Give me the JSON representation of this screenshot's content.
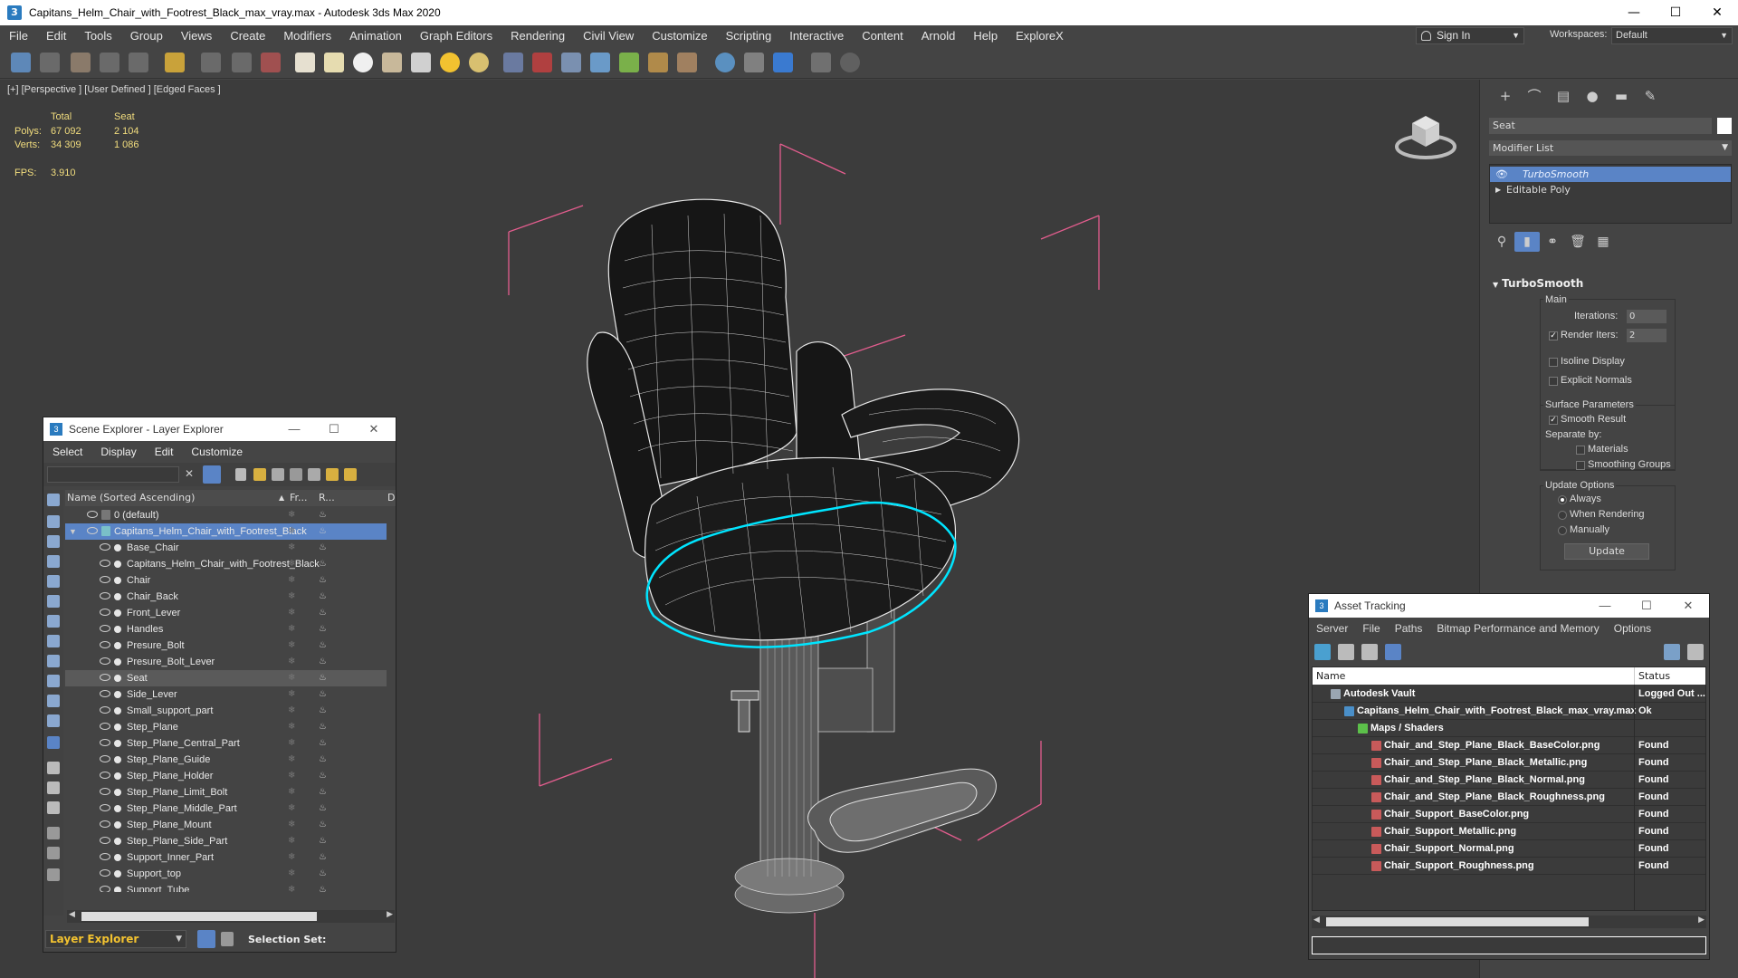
{
  "window": {
    "title": "Capitans_Helm_Chair_with_Footrest_Black_max_vray.max - Autodesk 3ds Max 2020",
    "app_icon": "3",
    "minimize": "—",
    "maximize": "☐",
    "close": "✕"
  },
  "menubar": {
    "items": [
      "File",
      "Edit",
      "Tools",
      "Group",
      "Views",
      "Create",
      "Modifiers",
      "Animation",
      "Graph Editors",
      "Rendering",
      "Civil View",
      "Customize",
      "Scripting",
      "Interactive",
      "Content",
      "Arnold",
      "Help",
      "ExploreX"
    ],
    "sign_in": "Sign In",
    "workspaces_label": "Workspaces:",
    "workspace_value": "Default"
  },
  "viewport": {
    "label": "[+] [Perspective ] [User Defined ] [Edged Faces ]",
    "stats": {
      "header_total": "Total",
      "header_seat": "Seat",
      "polys_label": "Polys:",
      "polys_total": "67 092",
      "polys_seat": "2 104",
      "verts_label": "Verts:",
      "verts_total": "34 309",
      "verts_seat": "1 086",
      "fps_label": "FPS:",
      "fps_value": "3.910"
    }
  },
  "command_panel": {
    "tabs": [
      "+",
      "⌒",
      "▤",
      "●",
      "▬",
      "✎"
    ],
    "object_name": "Seat",
    "modifier_list": "Modifier List",
    "stack": [
      "TurboSmooth",
      "Editable Poly"
    ],
    "stack_tools": [
      "⚲",
      "▮",
      "⚭",
      "🗑",
      "▦"
    ],
    "rollout": {
      "title": "TurboSmooth",
      "main": "Main",
      "iterations_label": "Iterations:",
      "iterations_value": "0",
      "render_iters_label": "Render Iters:",
      "render_iters_value": "2",
      "isoline": "Isoline Display",
      "explicit_normals": "Explicit Normals",
      "surface_params": "Surface Parameters",
      "smooth_result": "Smooth Result",
      "separate_by": "Separate by:",
      "materials": "Materials",
      "smoothing_groups": "Smoothing Groups",
      "update_options": "Update Options",
      "always": "Always",
      "when_rendering": "When Rendering",
      "manually": "Manually",
      "update_button": "Update"
    }
  },
  "scene_explorer": {
    "title": "Scene Explorer - Layer Explorer",
    "menu": [
      "Select",
      "Display",
      "Edit",
      "Customize"
    ],
    "col_name": "Name (Sorted Ascending)",
    "col_frozen": "Fr...",
    "col_render": "R...",
    "col_d": "D",
    "rows": [
      {
        "name": "0 (default)",
        "level": 0,
        "selected": false,
        "highlight": false
      },
      {
        "name": "Capitans_Helm_Chair_with_Footrest_Black",
        "level": 0,
        "selected": true,
        "highlight": false
      },
      {
        "name": "Base_Chair",
        "level": 1,
        "selected": false,
        "highlight": false
      },
      {
        "name": "Capitans_Helm_Chair_with_Footrest_Black",
        "level": 1,
        "selected": false,
        "highlight": false
      },
      {
        "name": "Chair",
        "level": 1,
        "selected": false,
        "highlight": false
      },
      {
        "name": "Chair_Back",
        "level": 1,
        "selected": false,
        "highlight": false
      },
      {
        "name": "Front_Lever",
        "level": 1,
        "selected": false,
        "highlight": false
      },
      {
        "name": "Handles",
        "level": 1,
        "selected": false,
        "highlight": false
      },
      {
        "name": "Presure_Bolt",
        "level": 1,
        "selected": false,
        "highlight": false
      },
      {
        "name": "Presure_Bolt_Lever",
        "level": 1,
        "selected": false,
        "highlight": false
      },
      {
        "name": "Seat",
        "level": 1,
        "selected": false,
        "highlight": true
      },
      {
        "name": "Side_Lever",
        "level": 1,
        "selected": false,
        "highlight": false
      },
      {
        "name": "Small_support_part",
        "level": 1,
        "selected": false,
        "highlight": false
      },
      {
        "name": "Step_Plane",
        "level": 1,
        "selected": false,
        "highlight": false
      },
      {
        "name": "Step_Plane_Central_Part",
        "level": 1,
        "selected": false,
        "highlight": false
      },
      {
        "name": "Step_Plane_Guide",
        "level": 1,
        "selected": false,
        "highlight": false
      },
      {
        "name": "Step_Plane_Holder",
        "level": 1,
        "selected": false,
        "highlight": false
      },
      {
        "name": "Step_Plane_Limit_Bolt",
        "level": 1,
        "selected": false,
        "highlight": false
      },
      {
        "name": "Step_Plane_Middle_Part",
        "level": 1,
        "selected": false,
        "highlight": false
      },
      {
        "name": "Step_Plane_Mount",
        "level": 1,
        "selected": false,
        "highlight": false
      },
      {
        "name": "Step_Plane_Side_Part",
        "level": 1,
        "selected": false,
        "highlight": false
      },
      {
        "name": "Support_Inner_Part",
        "level": 1,
        "selected": false,
        "highlight": false
      },
      {
        "name": "Support_top",
        "level": 1,
        "selected": false,
        "highlight": false
      },
      {
        "name": "Support_Tube",
        "level": 1,
        "selected": false,
        "highlight": false
      }
    ],
    "footer_explorer": "Layer Explorer",
    "selection_set": "Selection Set:"
  },
  "asset_tracking": {
    "title": "Asset Tracking",
    "menu": [
      "Server",
      "File",
      "Paths",
      "Bitmap Performance and Memory",
      "Options"
    ],
    "col_name": "Name",
    "col_status": "Status",
    "rows": [
      {
        "name": "Autodesk Vault",
        "status": "Logged Out ...",
        "level": 0,
        "icon": "vault"
      },
      {
        "name": "Capitans_Helm_Chair_with_Footrest_Black_max_vray.max",
        "status": "Ok",
        "level": 1,
        "icon": "max"
      },
      {
        "name": "Maps / Shaders",
        "status": "",
        "level": 2,
        "icon": "maps"
      },
      {
        "name": "Chair_and_Step_Plane_Black_BaseColor.png",
        "status": "Found",
        "level": 3,
        "icon": "png"
      },
      {
        "name": "Chair_and_Step_Plane_Black_Metallic.png",
        "status": "Found",
        "level": 3,
        "icon": "png"
      },
      {
        "name": "Chair_and_Step_Plane_Black_Normal.png",
        "status": "Found",
        "level": 3,
        "icon": "png"
      },
      {
        "name": "Chair_and_Step_Plane_Black_Roughness.png",
        "status": "Found",
        "level": 3,
        "icon": "png"
      },
      {
        "name": "Chair_Support_BaseColor.png",
        "status": "Found",
        "level": 3,
        "icon": "png"
      },
      {
        "name": "Chair_Support_Metallic.png",
        "status": "Found",
        "level": 3,
        "icon": "png"
      },
      {
        "name": "Chair_Support_Normal.png",
        "status": "Found",
        "level": 3,
        "icon": "png"
      },
      {
        "name": "Chair_Support_Roughness.png",
        "status": "Found",
        "level": 3,
        "icon": "png"
      }
    ]
  },
  "colors": {
    "selection_blue": "#5a84c6",
    "stats_yellow": "#f2dd7e",
    "highlight_cyan": "#00e5ff",
    "bbox_pink": "#e35d8e"
  }
}
